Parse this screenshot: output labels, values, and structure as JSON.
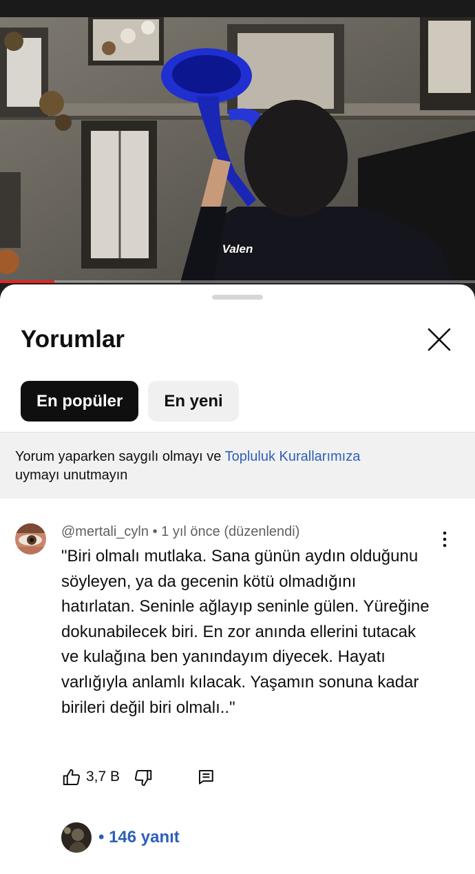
{
  "video": {
    "caption": "Valen",
    "progress": 0.115,
    "progress_color": "#e52420"
  },
  "comments_sheet": {
    "title": "Yorumlar",
    "close_icon": "close-icon",
    "sort_chips": [
      {
        "label": "En popüler",
        "selected": true
      },
      {
        "label": "En yeni",
        "selected": false
      }
    ],
    "notice": {
      "text_before": "Yorum yaparken saygılı olmayı ve ",
      "link": "Topluluk Kurallarımıza",
      "text_after": "uymayı unutmayın"
    },
    "comment": {
      "author": "@mertali_cyln",
      "separator": "•",
      "time": "1 yıl önce (düzenlendi)",
      "text": "\"Biri olmalı mutlaka. Sana günün aydın olduğunu söyleyen, ya da gecenin kötü olmadığını hatırlatan. Seninle ağlayıp seninle gülen. Yüreğine dokunabilecek biri. En zor anında ellerini tutacak ve kulağına ben yanındayım diyecek. Hayatı varlığıyla anlamlı kılacak. Yaşamın sonuna kadar birileri değil biri olmalı..\"",
      "likes": "3,7 B",
      "replies_label": "• 146 yanıt"
    },
    "colors": {
      "link": "#2c5fb8",
      "chip_active": "#0f0f0f",
      "chip_inactive": "#f0f0f0",
      "notice_bg": "#f1f1f1"
    }
  }
}
